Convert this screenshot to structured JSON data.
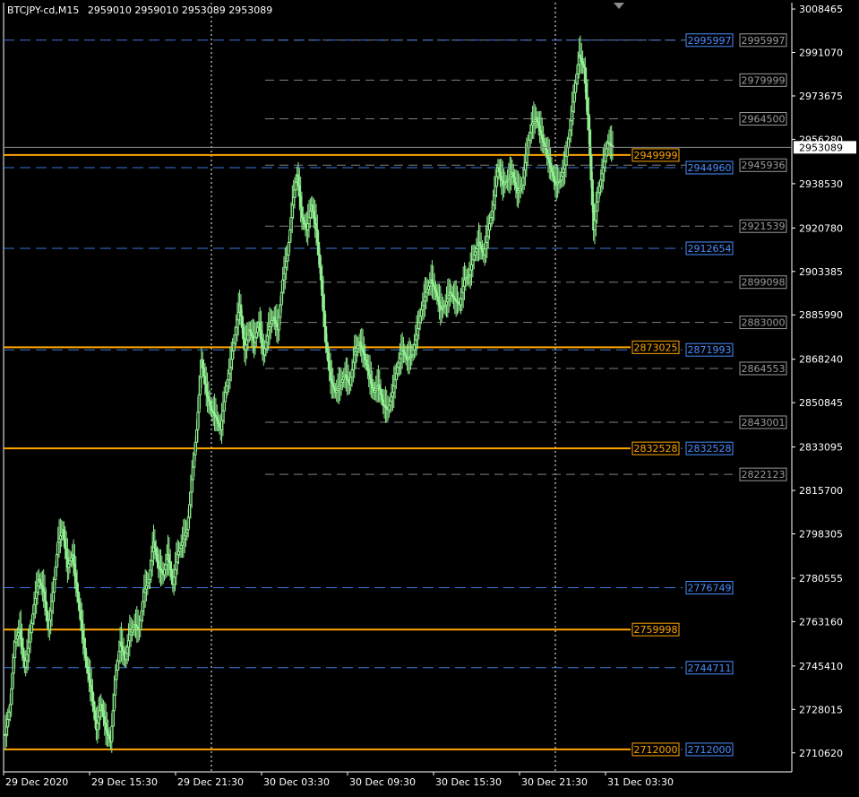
{
  "header": {
    "symbol_timeframe": "BTCJPY-cd,M15",
    "ohlc": "2959010 2959010 2953089 2953089"
  },
  "colors": {
    "background": "#000000",
    "axis": "#ffffff",
    "candle": "#90ee90",
    "grid": "#ffffff",
    "orange_level": "#ffa500",
    "blue_level": "#3c78d8",
    "gray_level": "#7f7f7f",
    "current_price": "#8c8c8c"
  },
  "chart_data": {
    "type": "candlestick",
    "symbol": "BTCJPY-cd",
    "timeframe": "M15",
    "ylim": [
      2703000,
      3011000
    ],
    "y_ticks": [
      "3008465",
      "2991070",
      "2973675",
      "2956280",
      "2938530",
      "2920780",
      "2903385",
      "2885990",
      "2868240",
      "2850845",
      "2833095",
      "2815700",
      "2798305",
      "2780555",
      "2763160",
      "2745410",
      "2728015",
      "2710620"
    ],
    "x_ticks": [
      "29 Dec 2020",
      "29 Dec 15:30",
      "29 Dec 21:30",
      "30 Dec 03:30",
      "30 Dec 09:30",
      "30 Dec 15:30",
      "30 Dec 21:30",
      "31 Dec 03:30"
    ],
    "period_separators": [
      "29 Dec 21:30",
      "30 Dec 21:30"
    ],
    "current_price": "2953089",
    "levels": {
      "orange": [
        "2949999",
        "2873025",
        "2832528",
        "2759998",
        "2712000"
      ],
      "blue": [
        "2995997",
        "2944960",
        "2912654",
        "2871993",
        "2832528",
        "2776749",
        "2744711",
        "2712000"
      ],
      "gray": [
        "2995997",
        "2979999",
        "2964500",
        "2945936",
        "2921539",
        "2899098",
        "2883000",
        "2864553",
        "2843001",
        "2822123"
      ]
    },
    "series": {
      "close_path": [
        [
          2718000,
          2730000,
          2755000,
          2760000,
          2745000,
          2755000,
          2770000,
          2780000,
          2775000,
          2760000,
          2775000,
          2795000,
          2800000,
          2785000,
          2790000,
          2775000,
          2760000,
          2745000,
          2735000,
          2720000,
          2730000,
          2720000,
          2715000,
          2740000,
          2755000,
          2748000,
          2758000,
          2762000,
          2760000,
          2775000,
          2780000,
          2795000,
          2785000,
          2782000,
          2790000,
          2778000,
          2790000,
          2795000,
          2800000,
          2820000,
          2840000,
          2868000,
          2855000,
          2848000,
          2845000,
          2840000,
          2855000,
          2865000,
          2878000,
          2890000,
          2872000,
          2880000,
          2875000,
          2883000,
          2870000,
          2880000,
          2885000,
          2880000,
          2900000,
          2910000,
          2930000,
          2942000,
          2925000,
          2920000,
          2930000,
          2920000,
          2900000,
          2875000,
          2860000,
          2855000,
          2858000,
          2862000,
          2858000,
          2870000,
          2875000,
          2870000,
          2862000,
          2855000,
          2858000,
          2850000,
          2848000,
          2855000,
          2865000,
          2872000,
          2868000,
          2870000,
          2878000,
          2888000,
          2895000,
          2900000,
          2895000,
          2888000,
          2890000,
          2895000,
          2892000,
          2890000,
          2900000,
          2902000,
          2910000,
          2915000,
          2910000,
          2920000,
          2930000,
          2945000,
          2938000,
          2940000,
          2943000,
          2935000,
          2938000,
          2950000,
          2962000,
          2965000,
          2958000,
          2952000,
          2945000,
          2938000,
          2940000,
          2946000,
          2960000,
          2975000,
          2990000,
          2985000,
          2960000,
          2920000,
          2935000,
          2945000,
          2955000,
          2953089
        ]
      ]
    }
  }
}
